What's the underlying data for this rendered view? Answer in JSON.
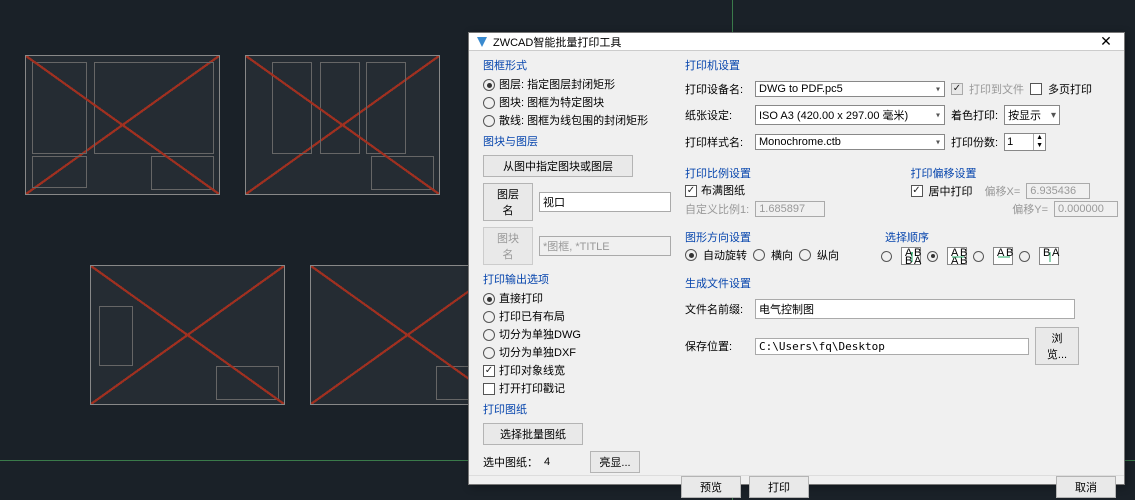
{
  "window": {
    "title": "ZWCAD智能批量打印工具",
    "close": "✕"
  },
  "left": {
    "frame_type": {
      "title": "图框形式",
      "opts": [
        "图层: 指定图层封闭矩形",
        "图块: 图框为特定图块",
        "散线: 图框为线包围的封闭矩形"
      ],
      "selected": 0
    },
    "block_layer": {
      "title": "图块与图层",
      "from_button": "从图中指定图块或图层",
      "layer_btn": "图层名",
      "layer_val": "视口",
      "block_btn": "图块名",
      "block_val": "*图框, *TITLE"
    },
    "output": {
      "title": "打印输出选项",
      "opts": [
        "直接打印",
        "打印已有布局",
        "切分为单独DWG",
        "切分为单独DXF"
      ],
      "selected": 0,
      "chk_linewidth": "打印对象线宽",
      "chk_linewidth_on": true,
      "chk_stamp": "打开打印戳记",
      "chk_stamp_on": false
    },
    "sheets": {
      "title": "打印图纸",
      "select_btn": "选择批量图纸",
      "count_label": "选中图纸：",
      "count": "4",
      "highlight_btn": "亮显..."
    }
  },
  "right": {
    "printer": {
      "title": "打印机设置",
      "device_label": "打印设备名:",
      "device_val": "DWG to PDF.pc5",
      "print_to_file": "打印到文件",
      "print_to_file_on": true,
      "multipage": "多页打印",
      "multipage_on": false,
      "paper_label": "纸张设定:",
      "paper_val": "ISO A3 (420.00 x 297.00 毫米)",
      "color_label": "着色打印:",
      "color_val": "按显示",
      "style_label": "打印样式名:",
      "style_val": "Monochrome.ctb",
      "copies_label": "打印份数:",
      "copies_val": "1"
    },
    "scale": {
      "title": "打印比例设置",
      "fit": "布满图纸",
      "fit_on": true,
      "custom_label": "自定义比例1:",
      "custom_val": "1.685897"
    },
    "offset": {
      "title": "打印偏移设置",
      "center": "居中打印",
      "center_on": true,
      "ox_label": "偏移X=",
      "ox_val": "6.935436",
      "oy_label": "偏移Y=",
      "oy_val": "0.000000"
    },
    "orient": {
      "title": "图形方向设置",
      "auto": "自动旋转",
      "h": "横向",
      "v": "纵向",
      "selected": 0
    },
    "order": {
      "title": "选择顺序",
      "selected": 1
    },
    "file": {
      "title": "生成文件设置",
      "prefix_label": "文件名前缀:",
      "prefix_val": "电气控制图",
      "path_label": "保存位置:",
      "path_val": "C:\\Users\\fq\\Desktop",
      "browse": "浏览..."
    }
  },
  "footer": {
    "preview": "预览",
    "print": "打印",
    "cancel": "取消"
  }
}
